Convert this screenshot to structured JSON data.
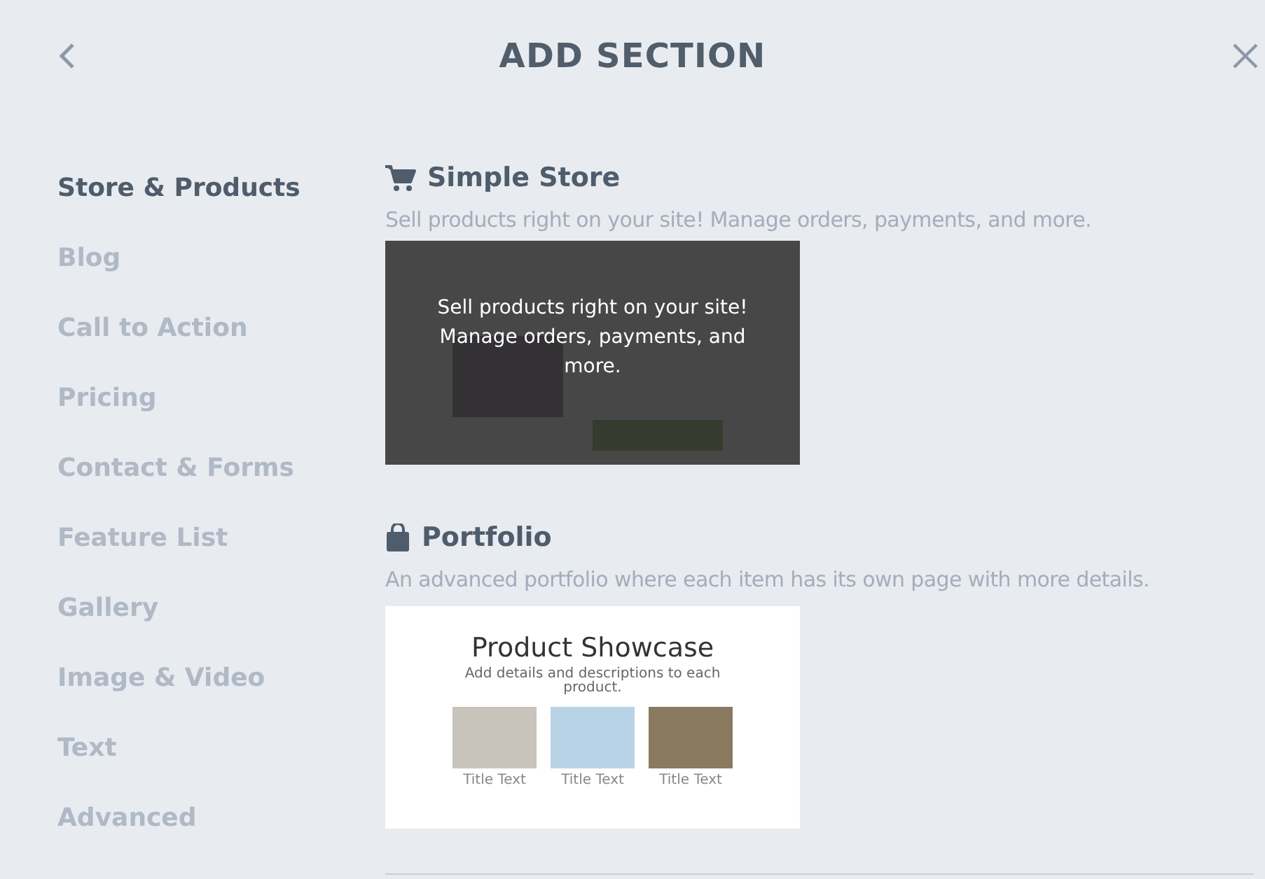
{
  "header": {
    "title": "ADD SECTION"
  },
  "categories": [
    {
      "label": "Store & Products",
      "selected": true
    },
    {
      "label": "Blog",
      "selected": false
    },
    {
      "label": "Call to Action",
      "selected": false
    },
    {
      "label": "Pricing",
      "selected": false
    },
    {
      "label": "Contact & Forms",
      "selected": false
    },
    {
      "label": "Feature List",
      "selected": false
    },
    {
      "label": "Gallery",
      "selected": false
    },
    {
      "label": "Image & Video",
      "selected": false
    },
    {
      "label": "Text",
      "selected": false
    },
    {
      "label": "Advanced",
      "selected": false
    }
  ],
  "sections": [
    {
      "kind": "store",
      "title": "Simple Store",
      "description": "Sell products right on your site! Manage orders, payments, and more.",
      "preview": {
        "overlay_text": "Sell products right on your site! Manage orders, payments, and more."
      }
    },
    {
      "kind": "portfolio",
      "title": "Portfolio",
      "description": "An advanced portfolio where each item has its own page with more details.",
      "preview": {
        "heading": "Product Showcase",
        "subheading": "Add details and descriptions to each product.",
        "items": [
          {
            "title": "Title Text"
          },
          {
            "title": "Title Text"
          },
          {
            "title": "Title Text"
          }
        ]
      }
    }
  ]
}
